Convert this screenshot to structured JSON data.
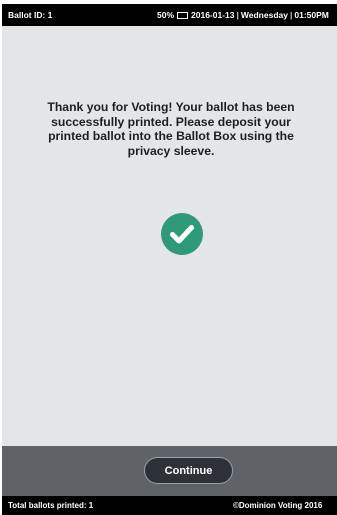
{
  "status_bar": {
    "ballot_id": "Ballot ID: 1",
    "battery": "50%",
    "date": "2016-01-13",
    "weekday": "Wednesday",
    "time": "01:50PM"
  },
  "main": {
    "message": "Thank you for Voting! Your ballot has been successfully printed. Please deposit your printed ballot into the Ballot Box using the privacy sleeve.",
    "success_icon": "check-circle-icon",
    "success_color": "#2f9a78"
  },
  "actions": {
    "continue_label": "Continue"
  },
  "footer": {
    "total_printed": "Total ballots printed: 1",
    "copyright": "©Dominion Voting 2016"
  }
}
